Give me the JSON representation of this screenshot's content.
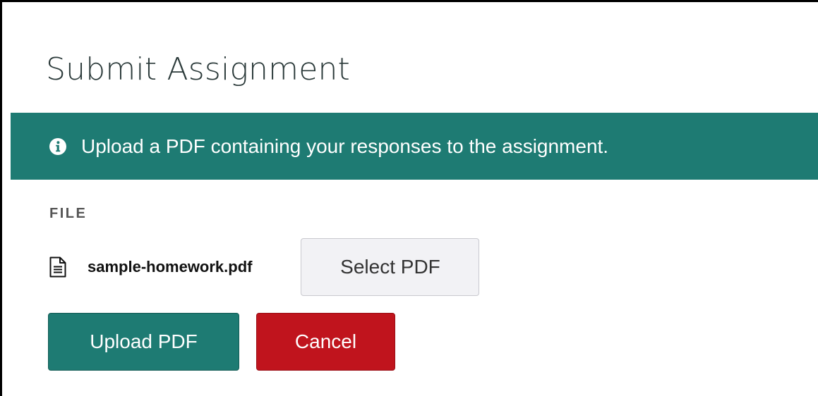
{
  "dialog": {
    "title": "Submit Assignment"
  },
  "banner": {
    "icon": "info-circle-icon",
    "message": "Upload a PDF containing your responses to the assignment.",
    "color": "#1e7b73"
  },
  "file_section": {
    "label": "FILE",
    "file_icon": "document-icon",
    "file_name": "sample-homework.pdf",
    "select_label": "Select PDF"
  },
  "actions": {
    "upload_label": "Upload PDF",
    "cancel_label": "Cancel",
    "upload_color": "#1e7b73",
    "cancel_color": "#c0141d"
  }
}
